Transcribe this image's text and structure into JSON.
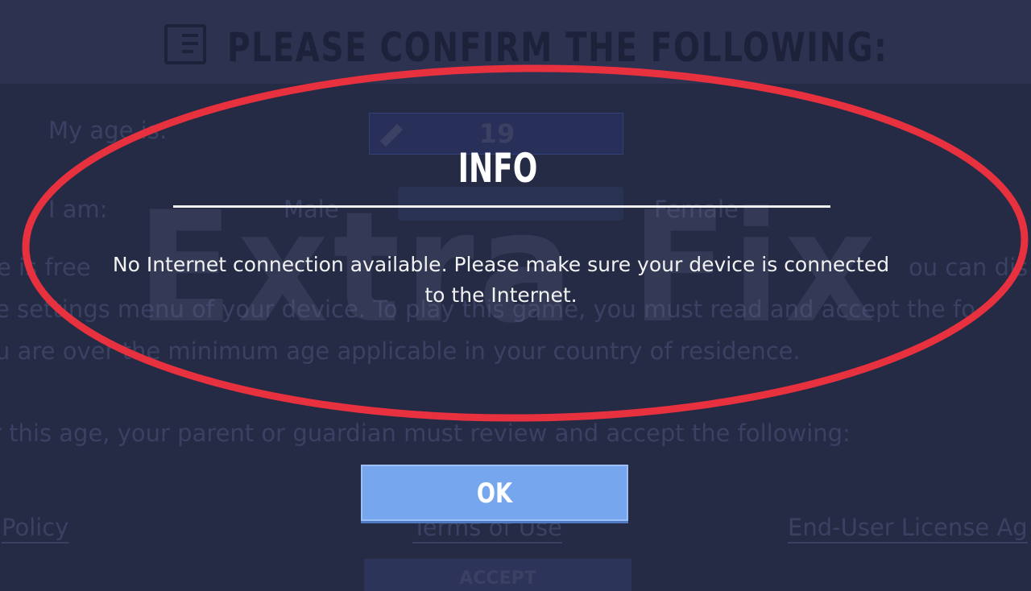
{
  "background": {
    "header_title": "PLEASE CONFIRM THE FOLLOWING:",
    "age_label": "My age is:",
    "age_value": "19",
    "gender_label": "I am:",
    "gender_male": "Male",
    "gender_female": "Female",
    "body_line1": "e is free",
    "body_line1_right": "ou can dis",
    "body_line2": "e settings menu of your device. To play this game, you must read and accept the fo",
    "body_line3": "u are over the minimum age applicable in your country of residence.",
    "body_line4": "r this age, your parent or guardian must review and accept the following:",
    "links": {
      "privacy_policy": "Policy",
      "terms_of_use": "Terms of Use",
      "eula": "End-User License Ag"
    },
    "accept_label": "ACCEPT"
  },
  "watermark": "Extra Fix",
  "dialog": {
    "title": "INFO",
    "message_line1": "No Internet connection available. Please make sure your device is connected",
    "message_line2": "to the Internet.",
    "ok_label": "OK"
  },
  "colors": {
    "background": "#252a45",
    "ok_button": "#76a7ee",
    "highlight_ellipse": "#e8313f"
  }
}
